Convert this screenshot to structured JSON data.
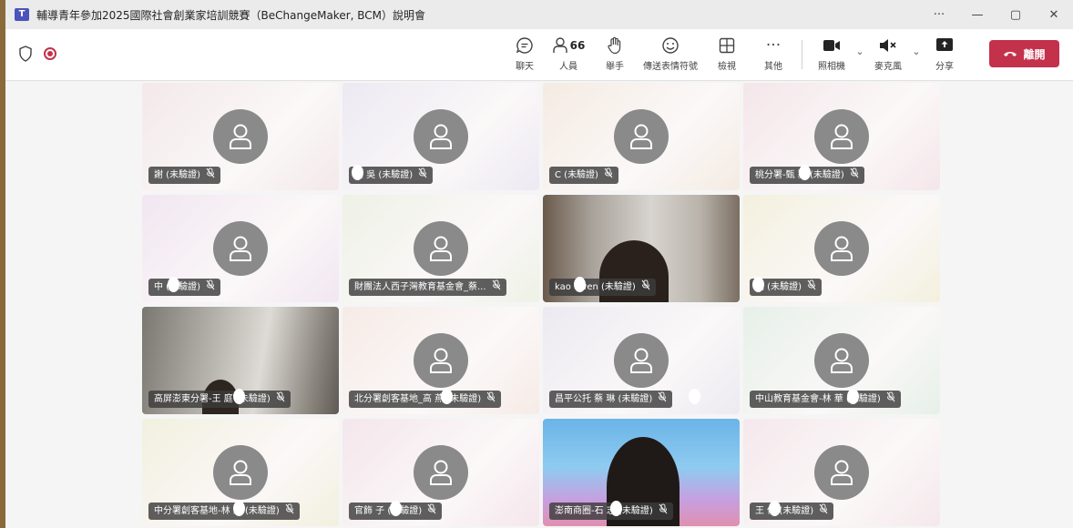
{
  "window": {
    "title": "輔導青年參加2025國際社會創業家培訓競賽（BeChangeMaker, BCM）說明會",
    "controls": {
      "more": "···",
      "minimize": "—",
      "restore": "▢",
      "close": "✕"
    }
  },
  "toolbar": {
    "chat_label": "聊天",
    "people_label": "人員",
    "people_count": "66",
    "raise_label": "舉手",
    "react_label": "傳送表情符號",
    "view_label": "檢視",
    "more_label": "其他",
    "camera_label": "照相機",
    "mic_label": "麥克風",
    "share_label": "分享",
    "leave_label": "離開"
  },
  "participants": [
    {
      "name": "謝 (未驗證)",
      "type": "avatar",
      "bg": "#f3e8ea"
    },
    {
      "name": "真 吳 (未驗證)",
      "type": "avatar",
      "bg": "#ece9f3"
    },
    {
      "name": "C (未驗證)",
      "type": "avatar",
      "bg": "#f4ebe2"
    },
    {
      "name": "桃分署-甄 潁 (未驗證)",
      "type": "avatar",
      "bg": "#f4e6ea"
    },
    {
      "name": "中 (未驗證)",
      "type": "avatar",
      "bg": "#f1e6f1"
    },
    {
      "name": "財團法人西子灣教育基金會_蔡...",
      "type": "avatar",
      "bg": "#eef1e6"
    },
    {
      "name": "kao owen (未驗證)",
      "type": "video-a",
      "bg": ""
    },
    {
      "name": "涵 (未驗證)",
      "type": "avatar",
      "bg": "#f3f0de"
    },
    {
      "name": "高屏澎東分署-王 庭 (未驗證)",
      "type": "video-b",
      "bg": ""
    },
    {
      "name": "北分署創客基地_高 燕 (未驗證)",
      "type": "avatar",
      "bg": "#f6ebe6"
    },
    {
      "name": "昌平公托 蔡 琳 (未驗證)",
      "type": "avatar",
      "bg": "#eceaf1"
    },
    {
      "name": "中山教育基金會-林 華 (未驗證)",
      "type": "avatar",
      "bg": "#e6f0e8"
    },
    {
      "name": "中分署創客基地-林 涵 (未驗證)",
      "type": "avatar",
      "bg": "#f2f0de"
    },
    {
      "name": "官飾 子 (未驗證)",
      "type": "avatar",
      "bg": "#f4e6ec"
    },
    {
      "name": "澎南商圈-石 志 (未驗證)",
      "type": "video-c",
      "bg": ""
    },
    {
      "name": "王 伸 (未驗證)",
      "type": "avatar",
      "bg": "#f5e8ec"
    }
  ]
}
